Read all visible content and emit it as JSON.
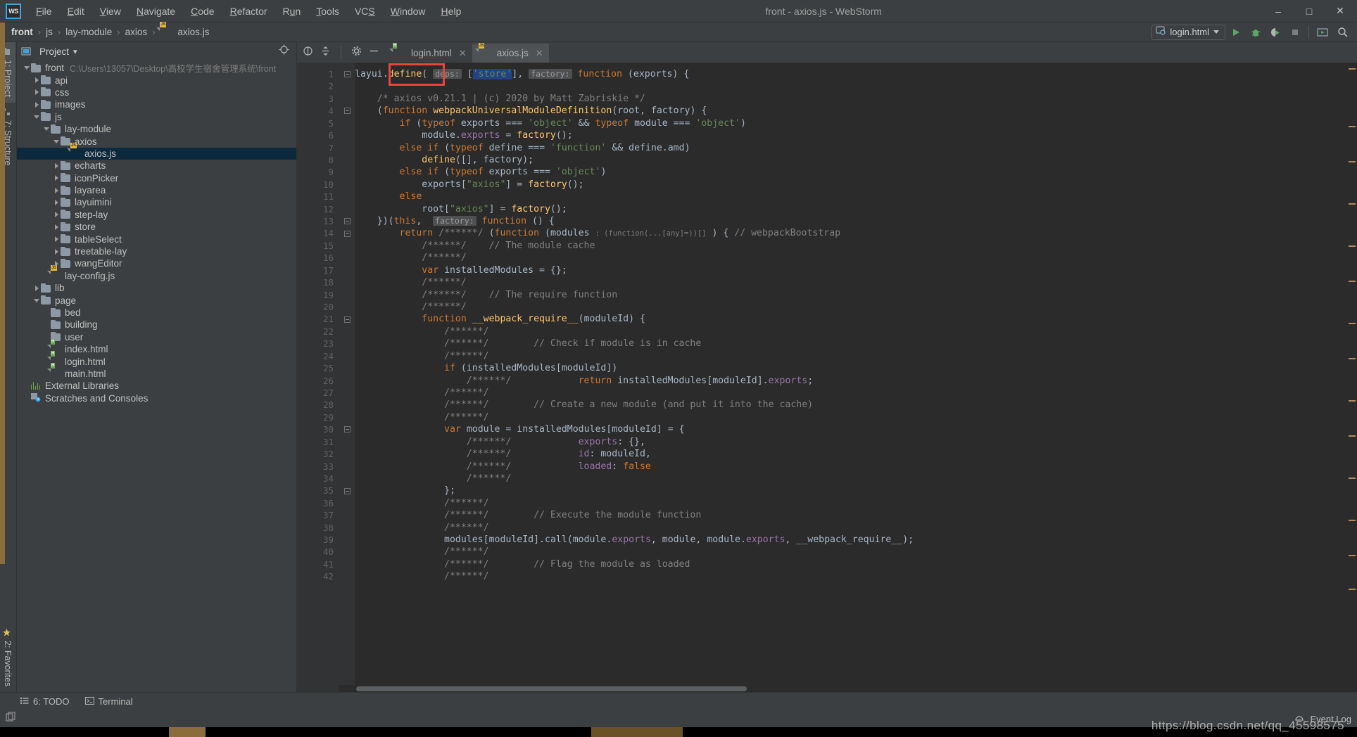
{
  "window": {
    "title": "front - axios.js - WebStorm",
    "logo": "WS",
    "minimize": "–",
    "maximize": "□",
    "close": "✕"
  },
  "menu": [
    {
      "label": "File"
    },
    {
      "label": "Edit"
    },
    {
      "label": "View"
    },
    {
      "label": "Navigate"
    },
    {
      "label": "Code"
    },
    {
      "label": "Refactor"
    },
    {
      "label": "Run"
    },
    {
      "label": "Tools"
    },
    {
      "label": "VCS"
    },
    {
      "label": "Window"
    },
    {
      "label": "Help"
    }
  ],
  "breadcrumb": {
    "separator": "›",
    "items": [
      "front",
      "js",
      "lay-module",
      "axios",
      "axios.js"
    ]
  },
  "run_widget": {
    "config_name": "login.html",
    "run_tooltip": "Run",
    "debug_tooltip": "Debug",
    "coverage_tooltip": "Run with Coverage",
    "stop_tooltip": "Stop",
    "preview_tooltip": "Preview",
    "search_tooltip": "Search Everywhere"
  },
  "left_strip": {
    "project_tab": "1: Project",
    "structure_tab": "7: Structure",
    "favorites_tab": "2: Favorites"
  },
  "project_panel": {
    "title": "Project",
    "dropdown_caret": "▾",
    "locate_icon": "crosshair-icon",
    "collapse_icon": "collapse-all-icon",
    "settings_icon": "gear-icon",
    "hide_icon": "minimize-icon",
    "tree": [
      {
        "label": "front",
        "path": "C:\\Users\\13057\\Desktop\\高校学生宿舍管理系统\\front",
        "indent": 0,
        "arrow": "down",
        "icon": "folder",
        "selected": false
      },
      {
        "label": "api",
        "indent": 1,
        "arrow": "right",
        "icon": "folder",
        "selected": false
      },
      {
        "label": "css",
        "indent": 1,
        "arrow": "right",
        "icon": "folder",
        "selected": false
      },
      {
        "label": "images",
        "indent": 1,
        "arrow": "right",
        "icon": "folder",
        "selected": false
      },
      {
        "label": "js",
        "indent": 1,
        "arrow": "down",
        "icon": "folder",
        "selected": false
      },
      {
        "label": "lay-module",
        "indent": 2,
        "arrow": "down",
        "icon": "folder",
        "selected": false
      },
      {
        "label": "axios",
        "indent": 3,
        "arrow": "down",
        "icon": "folder",
        "selected": false
      },
      {
        "label": "axios.js",
        "indent": 4,
        "arrow": "none",
        "icon": "js-file",
        "selected": true
      },
      {
        "label": "echarts",
        "indent": 3,
        "arrow": "right",
        "icon": "folder",
        "selected": false
      },
      {
        "label": "iconPicker",
        "indent": 3,
        "arrow": "right",
        "icon": "folder",
        "selected": false
      },
      {
        "label": "layarea",
        "indent": 3,
        "arrow": "right",
        "icon": "folder",
        "selected": false
      },
      {
        "label": "layuimini",
        "indent": 3,
        "arrow": "right",
        "icon": "folder",
        "selected": false
      },
      {
        "label": "step-lay",
        "indent": 3,
        "arrow": "right",
        "icon": "folder",
        "selected": false
      },
      {
        "label": "store",
        "indent": 3,
        "arrow": "right",
        "icon": "folder",
        "selected": false
      },
      {
        "label": "tableSelect",
        "indent": 3,
        "arrow": "right",
        "icon": "folder",
        "selected": false
      },
      {
        "label": "treetable-lay",
        "indent": 3,
        "arrow": "right",
        "icon": "folder",
        "selected": false
      },
      {
        "label": "wangEditor",
        "indent": 3,
        "arrow": "right",
        "icon": "folder",
        "selected": false
      },
      {
        "label": "lay-config.js",
        "indent": 2,
        "arrow": "none",
        "icon": "js-file",
        "selected": false
      },
      {
        "label": "lib",
        "indent": 1,
        "arrow": "right",
        "icon": "folder",
        "selected": false
      },
      {
        "label": "page",
        "indent": 1,
        "arrow": "down",
        "icon": "folder",
        "selected": false
      },
      {
        "label": "bed",
        "indent": 2,
        "arrow": "none",
        "icon": "folder",
        "selected": false
      },
      {
        "label": "building",
        "indent": 2,
        "arrow": "none",
        "icon": "folder",
        "selected": false
      },
      {
        "label": "user",
        "indent": 2,
        "arrow": "none",
        "icon": "folder",
        "selected": false
      },
      {
        "label": "index.html",
        "indent": 2,
        "arrow": "none",
        "icon": "html-file",
        "selected": false
      },
      {
        "label": "login.html",
        "indent": 2,
        "arrow": "none",
        "icon": "html-file",
        "selected": false
      },
      {
        "label": "main.html",
        "indent": 2,
        "arrow": "none",
        "icon": "html-file",
        "selected": false
      },
      {
        "label": "External Libraries",
        "indent": 0,
        "arrow": "none",
        "icon": "library",
        "selected": false
      },
      {
        "label": "Scratches and Consoles",
        "indent": 0,
        "arrow": "none",
        "icon": "scratches",
        "selected": false
      }
    ]
  },
  "editor": {
    "tabs": [
      {
        "label": "login.html",
        "icon": "html-file",
        "active": false,
        "close": "✕"
      },
      {
        "label": "axios.js",
        "icon": "js-file",
        "active": true,
        "close": "✕"
      }
    ],
    "first_line_number": 1,
    "last_line_number": 42,
    "annotation": {
      "type": "red-rectangle",
      "target": "['store'],"
    },
    "lines": [
      {
        "n": 1,
        "fold": true,
        "text": "layui.define( deps: ['store'], factory: function (exports) {"
      },
      {
        "n": 2,
        "fold": false,
        "text": ""
      },
      {
        "n": 3,
        "fold": false,
        "text": "    /* axios v0.21.1 | (c) 2020 by Matt Zabriskie */"
      },
      {
        "n": 4,
        "fold": true,
        "text": "    (function webpackUniversalModuleDefinition(root, factory) {"
      },
      {
        "n": 5,
        "fold": false,
        "text": "        if (typeof exports === 'object' && typeof module === 'object')"
      },
      {
        "n": 6,
        "fold": false,
        "text": "            module.exports = factory();"
      },
      {
        "n": 7,
        "fold": false,
        "text": "        else if (typeof define === 'function' && define.amd)"
      },
      {
        "n": 8,
        "fold": false,
        "text": "            define([], factory);"
      },
      {
        "n": 9,
        "fold": false,
        "text": "        else if (typeof exports === 'object')"
      },
      {
        "n": 10,
        "fold": false,
        "text": "            exports[\"axios\"] = factory();"
      },
      {
        "n": 11,
        "fold": false,
        "text": "        else"
      },
      {
        "n": 12,
        "fold": false,
        "text": "            root[\"axios\"] = factory();"
      },
      {
        "n": 13,
        "fold": true,
        "text": "    })(this,  factory: function () {"
      },
      {
        "n": 14,
        "fold": true,
        "text": "        return /******/ (function (modules : (function(...[any]=))[] ) { // webpackBootstrap"
      },
      {
        "n": 15,
        "fold": false,
        "text": "            /******/    // The module cache"
      },
      {
        "n": 16,
        "fold": false,
        "text": "            /******/"
      },
      {
        "n": 17,
        "fold": false,
        "text": "            var installedModules = {};"
      },
      {
        "n": 18,
        "fold": false,
        "text": "            /******/"
      },
      {
        "n": 19,
        "fold": false,
        "text": "            /******/    // The require function"
      },
      {
        "n": 20,
        "fold": false,
        "text": "            /******/"
      },
      {
        "n": 21,
        "fold": true,
        "text": "            function __webpack_require__(moduleId) {"
      },
      {
        "n": 22,
        "fold": false,
        "text": "                /******/"
      },
      {
        "n": 23,
        "fold": false,
        "text": "                /******/        // Check if module is in cache"
      },
      {
        "n": 24,
        "fold": false,
        "text": "                /******/"
      },
      {
        "n": 25,
        "fold": false,
        "text": "                if (installedModules[moduleId])"
      },
      {
        "n": 26,
        "fold": false,
        "text": "                    /******/            return installedModules[moduleId].exports;"
      },
      {
        "n": 27,
        "fold": false,
        "text": "                /******/"
      },
      {
        "n": 28,
        "fold": false,
        "text": "                /******/        // Create a new module (and put it into the cache)"
      },
      {
        "n": 29,
        "fold": false,
        "text": "                /******/"
      },
      {
        "n": 30,
        "fold": true,
        "text": "                var module = installedModules[moduleId] = {"
      },
      {
        "n": 31,
        "fold": false,
        "text": "                    /******/            exports: {},"
      },
      {
        "n": 32,
        "fold": false,
        "text": "                    /******/            id: moduleId,"
      },
      {
        "n": 33,
        "fold": false,
        "text": "                    /******/            loaded: false"
      },
      {
        "n": 34,
        "fold": false,
        "text": "                    /******/"
      },
      {
        "n": 35,
        "fold": true,
        "text": "                };"
      },
      {
        "n": 36,
        "fold": false,
        "text": "                /******/"
      },
      {
        "n": 37,
        "fold": false,
        "text": "                /******/        // Execute the module function"
      },
      {
        "n": 38,
        "fold": false,
        "text": "                /******/"
      },
      {
        "n": 39,
        "fold": false,
        "text": "                modules[moduleId].call(module.exports, module, module.exports, __webpack_require__);"
      },
      {
        "n": 40,
        "fold": false,
        "text": "                /******/"
      },
      {
        "n": 41,
        "fold": false,
        "text": "                /******/        // Flag the module as loaded"
      },
      {
        "n": 42,
        "fold": false,
        "text": "                /******/"
      }
    ]
  },
  "bottom_bar": {
    "todo": "6: TODO",
    "terminal": "Terminal"
  },
  "status_bar": {
    "event_log": "Event Log"
  },
  "watermark": "https://blog.csdn.net/qq_45598575",
  "colors": {
    "accent_blue": "#3ea4dd",
    "selection_blue": "#0d293e",
    "annotation_red": "#e8453c",
    "keyword_orange": "#cc7832",
    "string_green": "#6a8759",
    "function_yellow": "#ffc66d",
    "comment_gray": "#808080",
    "panel_bg": "#3c3f41",
    "editor_bg": "#2b2b2b"
  }
}
